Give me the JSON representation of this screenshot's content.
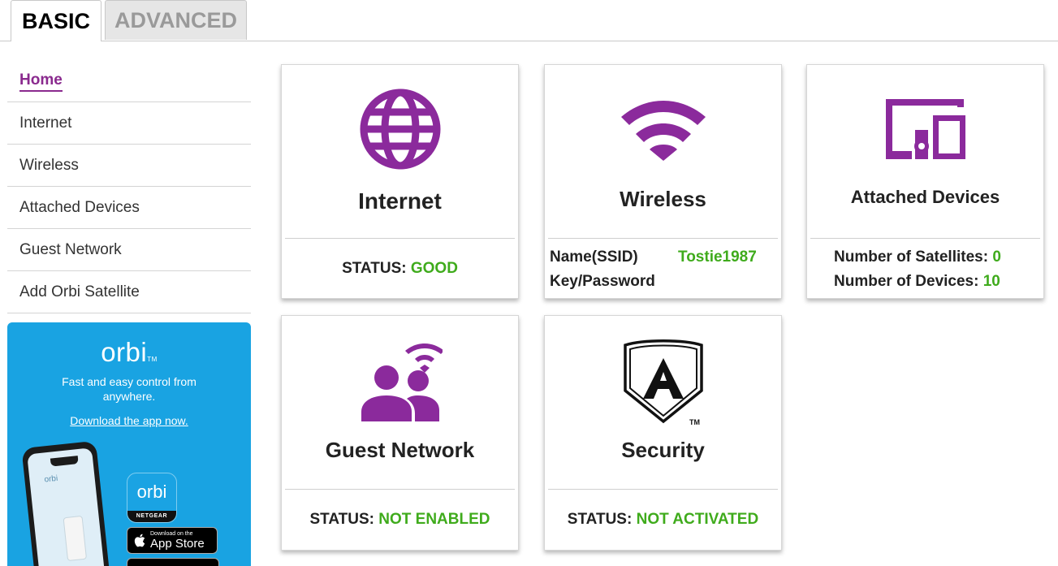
{
  "tabs": {
    "basic": "BASIC",
    "advanced": "ADVANCED"
  },
  "sidebar": {
    "items": [
      {
        "label": "Home"
      },
      {
        "label": "Internet"
      },
      {
        "label": "Wireless"
      },
      {
        "label": "Attached Devices"
      },
      {
        "label": "Guest Network"
      },
      {
        "label": "Add Orbi Satellite"
      }
    ],
    "active_index": 0
  },
  "promo": {
    "logo": "orbi",
    "tm": "TM",
    "tagline": "Fast and easy control from anywhere.",
    "download_link": "Download the app now.",
    "phone_app_label": "orbi",
    "app_icon_logo": "orbi",
    "app_icon_brand": "NETGEAR",
    "store_line1": "Download on the",
    "store_line2": "App Store"
  },
  "cards": {
    "internet": {
      "title": "Internet",
      "status_label": "STATUS:",
      "status_value": "GOOD",
      "icon": "globe-icon"
    },
    "wireless": {
      "title": "Wireless",
      "icon": "wifi-icon",
      "ssid_label": "Name(SSID)",
      "ssid_value": "Tostie1987",
      "key_label": "Key/Password",
      "key_value": ""
    },
    "attached": {
      "title": "Attached Devices",
      "icon": "devices-icon",
      "satellites_label": "Number of Satellites:",
      "satellites_value": "0",
      "devices_label": "Number of Devices:",
      "devices_value": "10"
    },
    "guest": {
      "title": "Guest Network",
      "status_label": "STATUS:",
      "status_value": "NOT ENABLED",
      "icon": "guest-users-icon"
    },
    "security": {
      "title": "Security",
      "status_label": "STATUS:",
      "status_value": "NOT ACTIVATED",
      "icon": "armor-shield-icon",
      "tm": "TM"
    }
  },
  "colors": {
    "accent_purple": "#8b2a9c",
    "status_green": "#3fab1c",
    "promo_blue": "#19a3e2"
  }
}
